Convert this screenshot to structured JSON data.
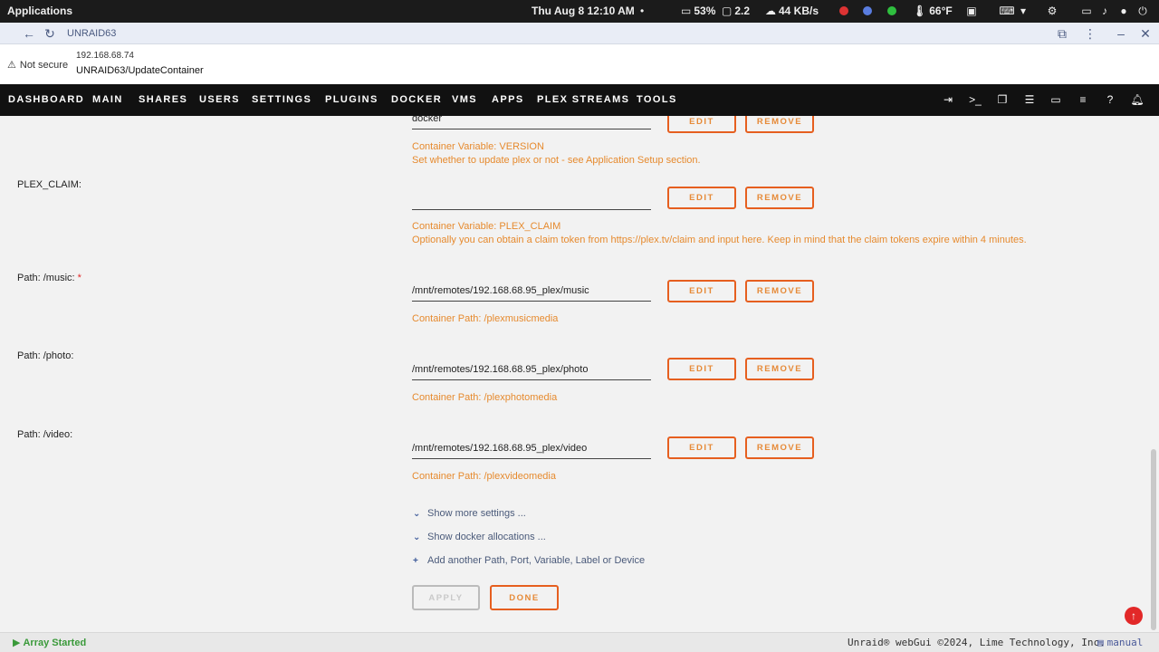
{
  "os_panel": {
    "applications": "Applications",
    "clock": "Thu Aug 8  12:10 AM",
    "dot": "•",
    "battery": "53%",
    "load": "2.2",
    "network": "44 KB/s",
    "temperature": "66°F"
  },
  "browser": {
    "tab_title": "UNRAID63",
    "security": "Not secure",
    "host": "192.168.68.74",
    "path": "UNRAID63/UpdateContainer"
  },
  "nav": {
    "items": [
      "DASHBOARD",
      "MAIN",
      "SHARES",
      "USERS",
      "SETTINGS",
      "PLUGINS",
      "DOCKER",
      "VMS",
      "APPS",
      "PLEX STREAMS",
      "TOOLS"
    ]
  },
  "buttons": {
    "edit": "EDIT",
    "remove": "REMOVE",
    "apply": "APPLY",
    "done": "DONE"
  },
  "fields": {
    "version": {
      "value": "docker",
      "desc1": "Container Variable: VERSION",
      "desc2": "Set whether to update plex or not - see Application Setup section."
    },
    "plex_claim": {
      "label": "PLEX_CLAIM:",
      "value": "",
      "desc1": "Container Variable: PLEX_CLAIM",
      "desc2": "Optionally you can obtain a claim token from https://plex.tv/claim and input here. Keep in mind that the claim tokens expire within 4 minutes."
    },
    "music": {
      "label": "Path: /music:",
      "required": "*",
      "value": "/mnt/remotes/192.168.68.95_plex/music",
      "desc": "Container Path: /plexmusicmedia"
    },
    "photo": {
      "label": "Path: /photo:",
      "value": "/mnt/remotes/192.168.68.95_plex/photo",
      "desc": "Container Path: /plexphotomedia"
    },
    "video": {
      "label": "Path: /video:",
      "value": "/mnt/remotes/192.168.68.95_plex/video",
      "desc": "Container Path: /plexvideomedia"
    }
  },
  "links": {
    "more_settings": "Show more settings ...",
    "docker_alloc": "Show docker allocations ...",
    "add_another": "Add another Path, Port, Variable, Label or Device"
  },
  "footer": {
    "status": "Array Started",
    "copyright": "Unraid® webGui ©2024, Lime Technology, Inc.",
    "manual": "manual"
  }
}
